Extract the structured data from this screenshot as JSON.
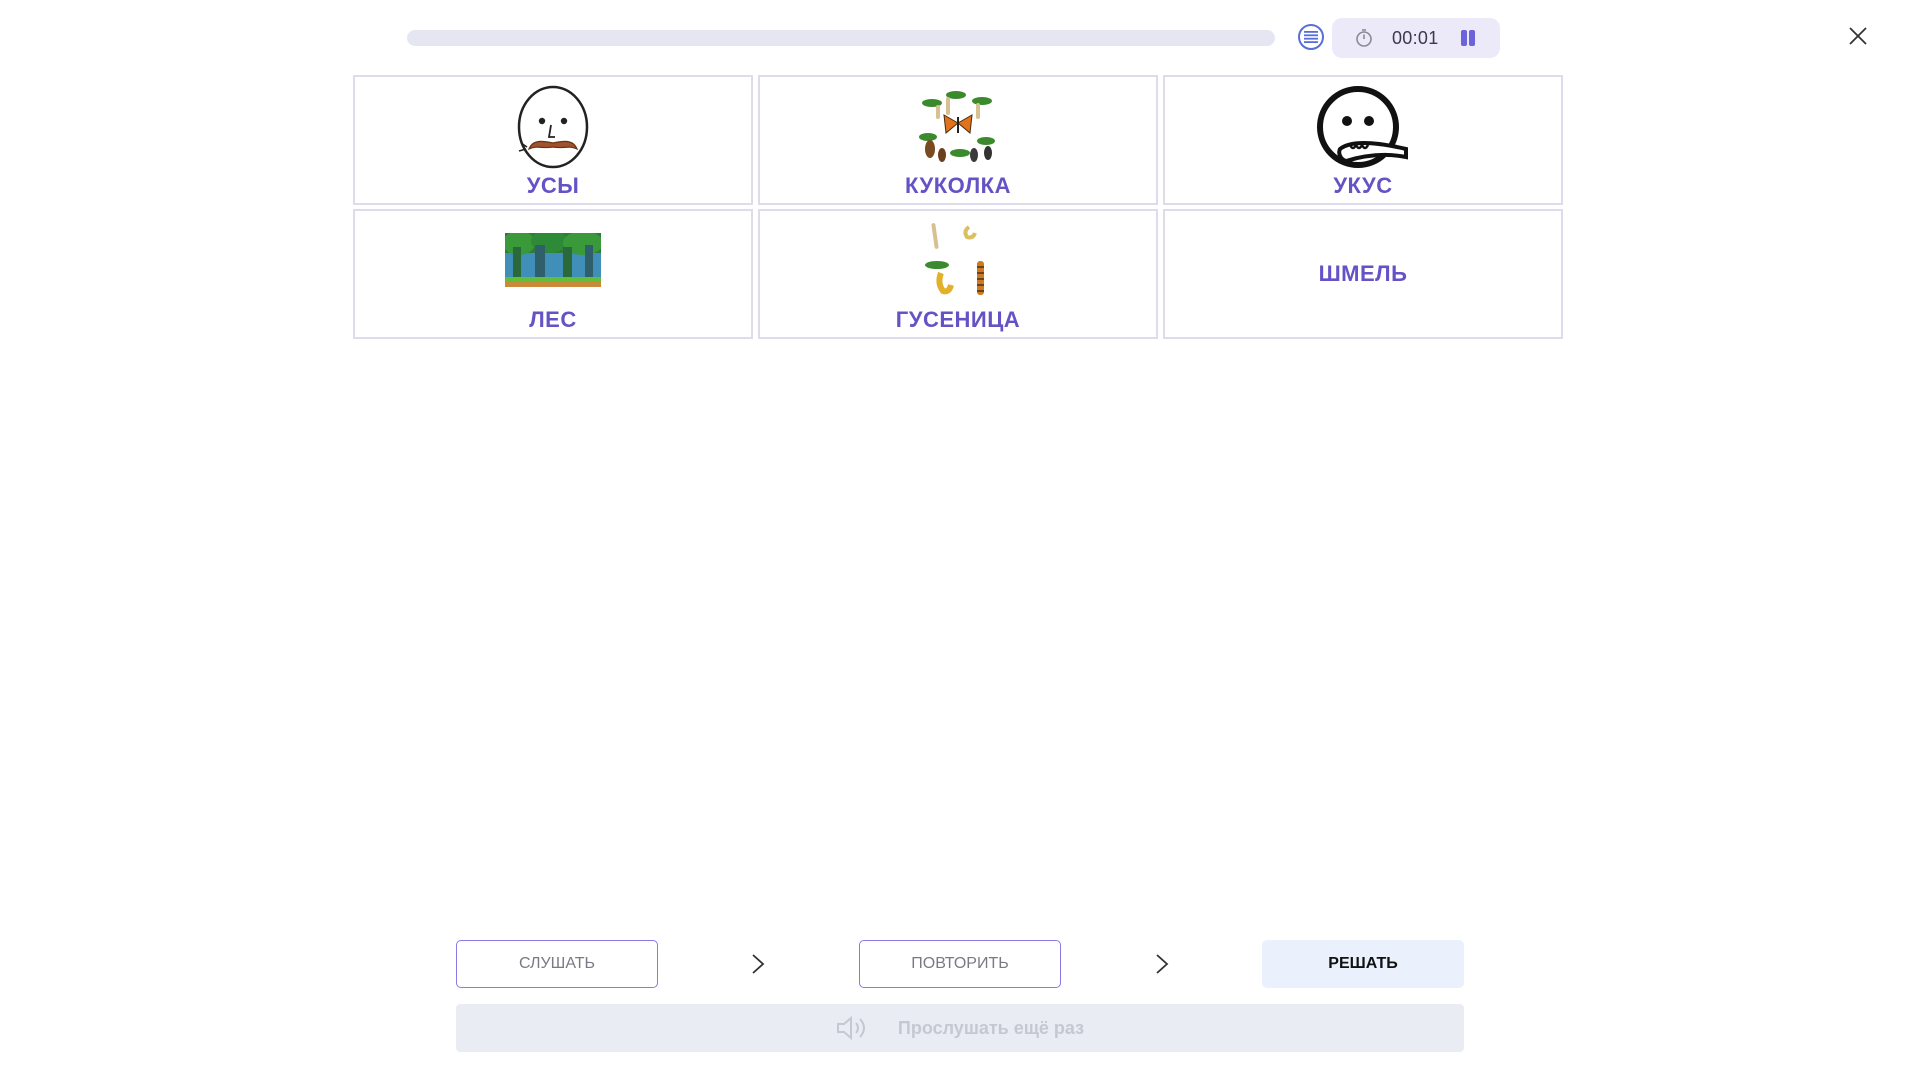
{
  "header": {
    "progress_fraction": 0.0,
    "timer": "00:01",
    "icons": {
      "list": "list-icon",
      "stopwatch": "stopwatch-icon",
      "pause": "pause-icon",
      "close": "close-icon"
    },
    "colors": {
      "accent": "#6b63dc",
      "track": "#e6e6f2"
    }
  },
  "cards": [
    {
      "label": "УСЫ",
      "image": "mustache-face-image"
    },
    {
      "label": "КУКОЛКА",
      "image": "butterfly-lifecycle-image"
    },
    {
      "label": "УКУС",
      "image": "bite-face-image"
    },
    {
      "label": "ЛЕС",
      "image": "forest-image"
    },
    {
      "label": "ГУСЕНИЦА",
      "image": "caterpillar-image"
    },
    {
      "label": "ШМЕЛЬ",
      "image": ""
    }
  ],
  "steps": {
    "listen": "СЛУШАТЬ",
    "repeat": "ПОВТОРИТЬ",
    "solve": "РЕШАТЬ"
  },
  "replay": {
    "label": "Прослушать ещё раз",
    "icon": "speaker-icon"
  },
  "colors": {
    "label": "#6553c6",
    "card_border": "#dcdcec",
    "step_border": "#8a7ae6",
    "solve_bg": "#eaf1fc",
    "replay_bg": "#e9ecf2"
  }
}
